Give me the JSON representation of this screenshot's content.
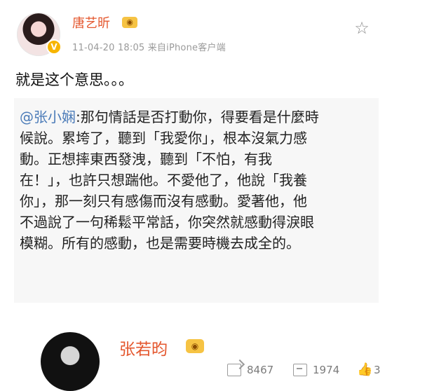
{
  "post": {
    "author": "唐艺昕",
    "meta": "11-04-20 18:05  来自iPhone客户端",
    "text": "就是这个意思。。。",
    "quote": {
      "mention": "@张小娴",
      "text": ":那句情話是否打動你，得要看是什麼時\n候說。累垮了，聽到「我愛你」，根本沒氣力感\n動。正想摔東西發洩，聽到「不怕，有我\n在！」，也許只想踹他。不愛他了，他說「我養\n你」，那一刻只有感傷而沒有感動。愛著他，他\n不過說了一句稀鬆平常話，你突然就感動得淚眼\n模糊。所有的感動，也是需要時機去成全的。"
    },
    "actions": {
      "reposts": "8467",
      "comments": "1974",
      "likes": "3"
    }
  },
  "next_post": {
    "author": "张若昀"
  },
  "colors": {
    "name": "#e4572e",
    "mention": "#4b7bb8",
    "quote_bg": "#f7f7f7",
    "meta": "#9a9a9a"
  },
  "icons": {
    "verified_badge": "verified-badge-icon",
    "favorite": "star-icon",
    "repost": "repost-icon",
    "comment": "comment-icon",
    "like": "thumbs-up-icon"
  }
}
